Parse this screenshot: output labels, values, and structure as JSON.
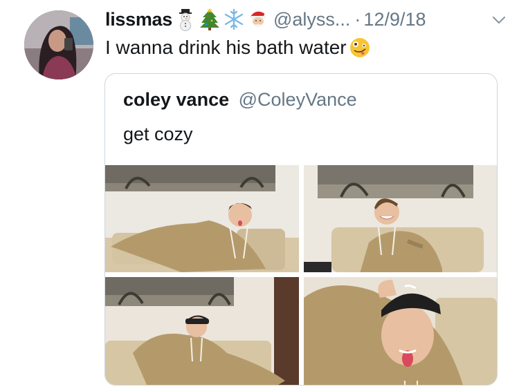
{
  "tweet": {
    "display_name": "lissmas",
    "name_emojis": [
      "snowman-emoji",
      "christmas-tree-emoji",
      "snowflake-emoji",
      "santa-emoji"
    ],
    "handle": "@alyss...",
    "separator": "·",
    "date": "12/9/18",
    "text": "I wanna drink his bath water",
    "text_emoji": "zany-face-emoji"
  },
  "quoted_tweet": {
    "display_name": "coley vance",
    "handle": "@ColeyVance",
    "text": "get cozy",
    "photos": [
      "photo-1",
      "photo-2",
      "photo-3",
      "photo-4"
    ]
  },
  "colors": {
    "text": "#14171a",
    "secondary": "#657786",
    "border": "#ccd6dd",
    "hoodie": "#b49a6b",
    "couch": "#d8c8a8"
  }
}
